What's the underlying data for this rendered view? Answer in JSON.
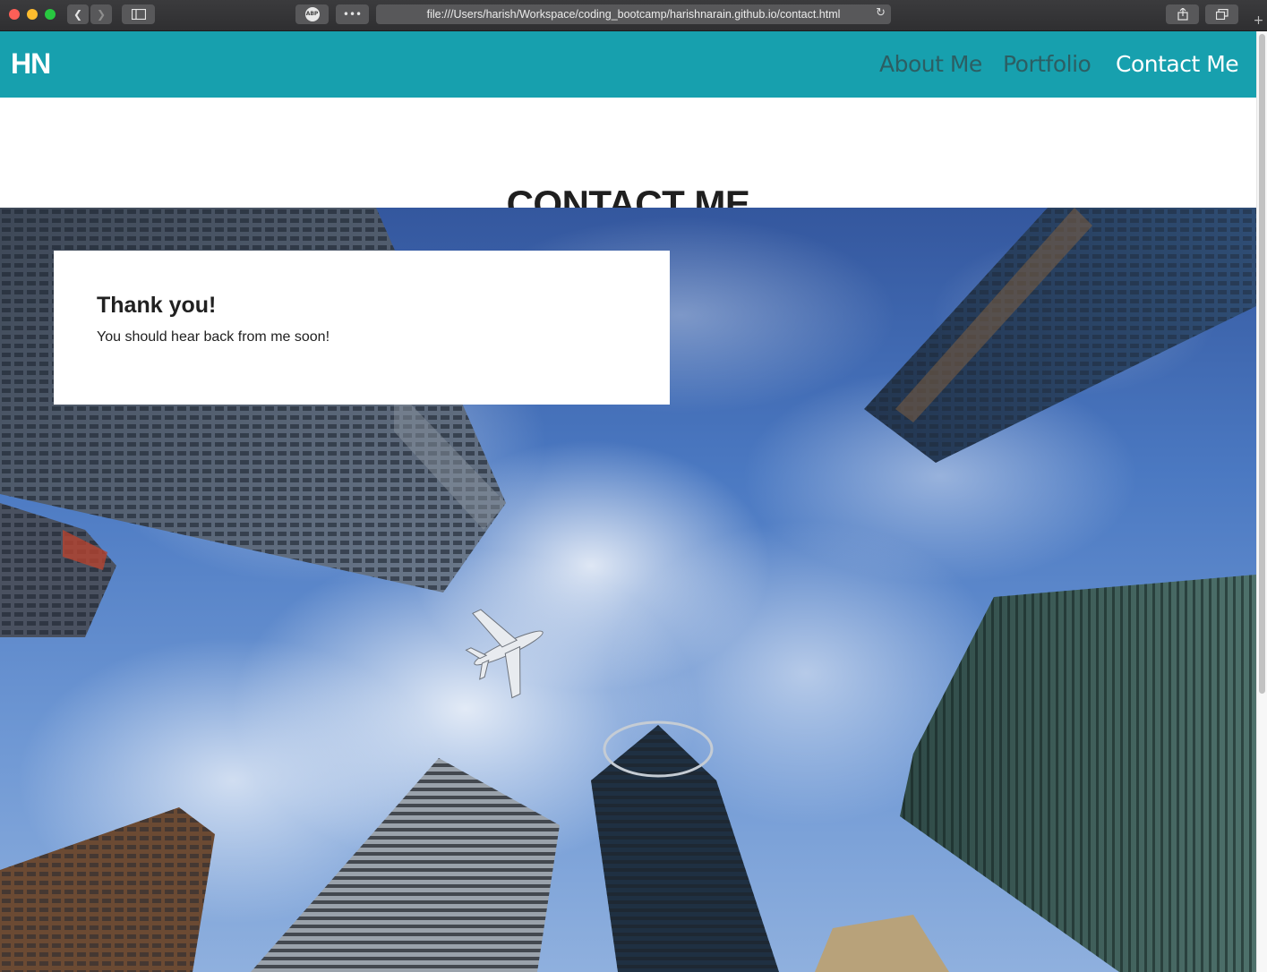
{
  "browser": {
    "url": "file:///Users/harish/Workspace/coding_bootcamp/harishnarain.github.io/contact.html",
    "adblock_label": "ABP"
  },
  "navbar": {
    "brand": "HN",
    "links": [
      {
        "label": "About Me",
        "active": false
      },
      {
        "label": "Portfolio",
        "active": false
      },
      {
        "label": "Contact Me",
        "active": true
      }
    ],
    "background_color": "#17a0ae"
  },
  "main": {
    "title": "CONTACT ME",
    "hero_image": "skyscrapers-looking-up-with-airplane",
    "card": {
      "heading": "Thank you!",
      "message": "You should hear back from me soon!"
    }
  }
}
